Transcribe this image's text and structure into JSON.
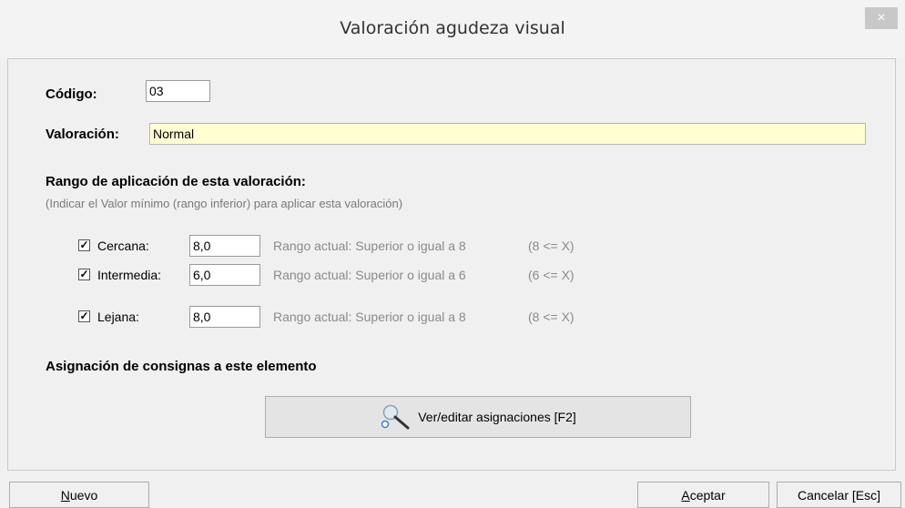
{
  "window": {
    "title": "Valoración agudeza visual",
    "close_label": "×"
  },
  "form": {
    "codigo_label": "Código:",
    "codigo_value": "03",
    "valoracion_label": "Valoración:",
    "valoracion_value": "Normal"
  },
  "rango": {
    "heading": "Rango de aplicación de esta valoración:",
    "hint": "(Indicar el Valor mínimo (rango inferior) para aplicar esta valoración)",
    "rows": [
      {
        "checked": true,
        "label": "Cercana:",
        "value": "8,0",
        "range_text": "Rango actual: Superior o igual a 8",
        "expr": "(8 <= X)"
      },
      {
        "checked": true,
        "label": "Intermedia:",
        "value": "6,0",
        "range_text": "Rango actual: Superior o igual a 6",
        "expr": "(6 <= X)"
      },
      {
        "checked": true,
        "label": "Lejana:",
        "value": "8,0",
        "range_text": "Rango actual: Superior o igual a 8",
        "expr": "(8 <= X)"
      }
    ]
  },
  "asignacion": {
    "heading": "Asignación de consignas a este elemento",
    "button_label": "Ver/editar asignaciones [F2]",
    "button_icon": "magnifier-icon"
  },
  "footer": {
    "nuevo_first": "N",
    "nuevo_rest": "uevo",
    "aceptar_first": "A",
    "aceptar_rest": "ceptar",
    "cancelar_label": "Cancelar [Esc]"
  }
}
